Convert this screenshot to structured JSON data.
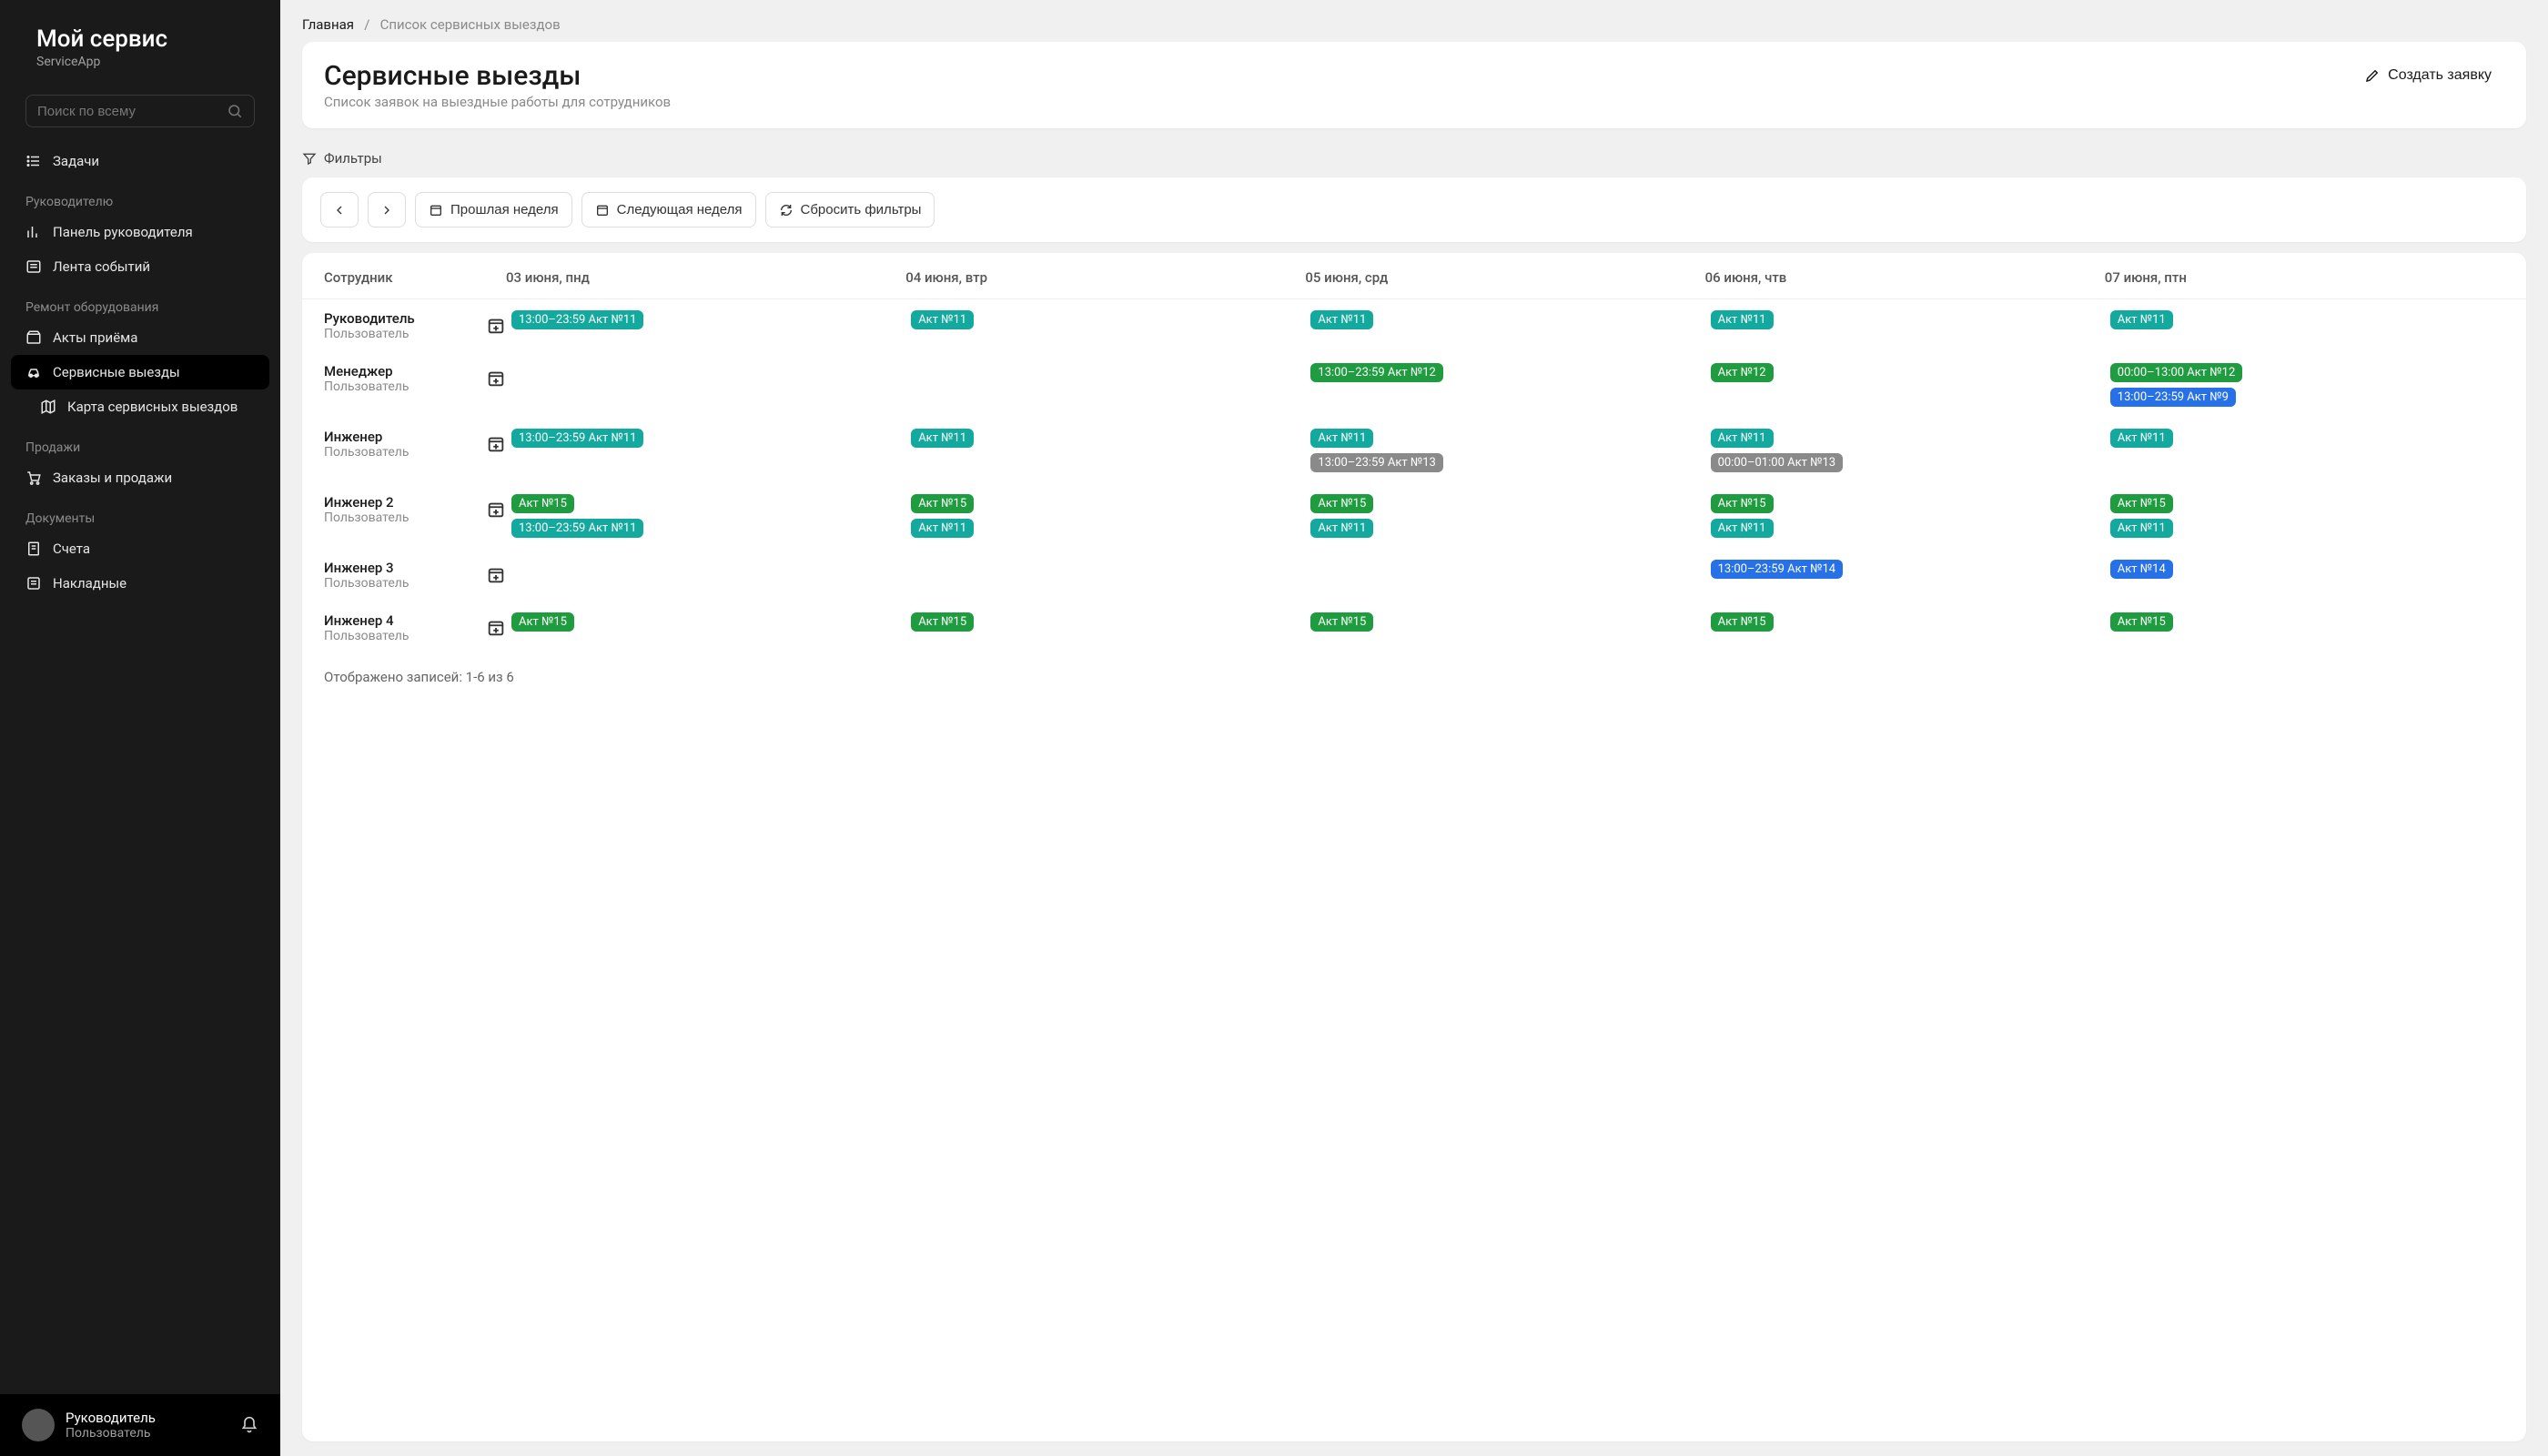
{
  "brand": {
    "title": "Мой сервис",
    "subtitle": "ServiceApp"
  },
  "search": {
    "placeholder": "Поиск по всему"
  },
  "nav": {
    "tasks": "Задачи",
    "section_manager": "Руководителю",
    "dashboard": "Панель руководителя",
    "feed": "Лента событий",
    "section_repair": "Ремонт оборудования",
    "acts": "Акты приёма",
    "service": "Сервисные выезды",
    "service_map": "Карта сервисных выездов",
    "section_sales": "Продажи",
    "orders": "Заказы и продажи",
    "section_docs": "Документы",
    "invoices": "Счета",
    "waybills": "Накладные"
  },
  "user": {
    "name": "Руководитель",
    "role": "Пользователь"
  },
  "breadcrumb": {
    "home": "Главная",
    "current": "Список сервисных выездов",
    "sep": "/"
  },
  "header": {
    "title": "Сервисные выезды",
    "subtitle": "Список заявок на выездные работы для сотрудников",
    "create": "Создать заявку"
  },
  "filters": {
    "label": "Фильтры"
  },
  "toolbar": {
    "prev_week": "Прошлая неделя",
    "next_week": "Следующая неделя",
    "reset": "Сбросить фильтры"
  },
  "columns": [
    "Сотрудник",
    "03 июня, пнд",
    "04 июня, втр",
    "05 июня, срд",
    "06 июня, чтв",
    "07 июня, птн"
  ],
  "rows": [
    {
      "name": "Руководитель",
      "role": "Пользователь",
      "days": [
        [
          {
            "label": "13:00–23:59 Акт №11",
            "color": "teal"
          }
        ],
        [
          {
            "label": "Акт №11",
            "color": "teal"
          }
        ],
        [
          {
            "label": "Акт №11",
            "color": "teal"
          }
        ],
        [
          {
            "label": "Акт №11",
            "color": "teal"
          }
        ],
        [
          {
            "label": "Акт №11",
            "color": "teal"
          }
        ]
      ]
    },
    {
      "name": "Менеджер",
      "role": "Пользователь",
      "days": [
        [],
        [],
        [
          {
            "label": "13:00–23:59 Акт №12",
            "color": "green"
          }
        ],
        [
          {
            "label": "Акт №12",
            "color": "green"
          }
        ],
        [
          {
            "label": "00:00–13:00 Акт №12",
            "color": "green"
          },
          {
            "label": "13:00–23:59 Акт №9",
            "color": "blue"
          }
        ]
      ]
    },
    {
      "name": "Инженер",
      "role": "Пользователь",
      "days": [
        [
          {
            "label": "13:00–23:59 Акт №11",
            "color": "teal"
          }
        ],
        [
          {
            "label": "Акт №11",
            "color": "teal"
          }
        ],
        [
          {
            "label": "Акт №11",
            "color": "teal"
          },
          {
            "label": "13:00–23:59 Акт №13",
            "color": "grey"
          }
        ],
        [
          {
            "label": "Акт №11",
            "color": "teal"
          },
          {
            "label": "00:00–01:00 Акт №13",
            "color": "grey"
          }
        ],
        [
          {
            "label": "Акт №11",
            "color": "teal"
          }
        ]
      ]
    },
    {
      "name": "Инженер 2",
      "role": "Пользователь",
      "days": [
        [
          {
            "label": "Акт №15",
            "color": "green"
          },
          {
            "label": "13:00–23:59 Акт №11",
            "color": "teal"
          }
        ],
        [
          {
            "label": "Акт №15",
            "color": "green"
          },
          {
            "label": "Акт №11",
            "color": "teal"
          }
        ],
        [
          {
            "label": "Акт №15",
            "color": "green"
          },
          {
            "label": "Акт №11",
            "color": "teal"
          }
        ],
        [
          {
            "label": "Акт №15",
            "color": "green"
          },
          {
            "label": "Акт №11",
            "color": "teal"
          }
        ],
        [
          {
            "label": "Акт №15",
            "color": "green"
          },
          {
            "label": "Акт №11",
            "color": "teal"
          }
        ]
      ]
    },
    {
      "name": "Инженер 3",
      "role": "Пользователь",
      "days": [
        [],
        [],
        [],
        [
          {
            "label": "13:00–23:59 Акт №14",
            "color": "blue"
          }
        ],
        [
          {
            "label": "Акт №14",
            "color": "blue"
          }
        ]
      ]
    },
    {
      "name": "Инженер 4",
      "role": "Пользователь",
      "days": [
        [
          {
            "label": "Акт №15",
            "color": "green"
          }
        ],
        [
          {
            "label": "Акт №15",
            "color": "green"
          }
        ],
        [
          {
            "label": "Акт №15",
            "color": "green"
          }
        ],
        [
          {
            "label": "Акт №15",
            "color": "green"
          }
        ],
        [
          {
            "label": "Акт №15",
            "color": "green"
          }
        ]
      ]
    }
  ],
  "footer": "Отображено записей: 1-6 из 6"
}
